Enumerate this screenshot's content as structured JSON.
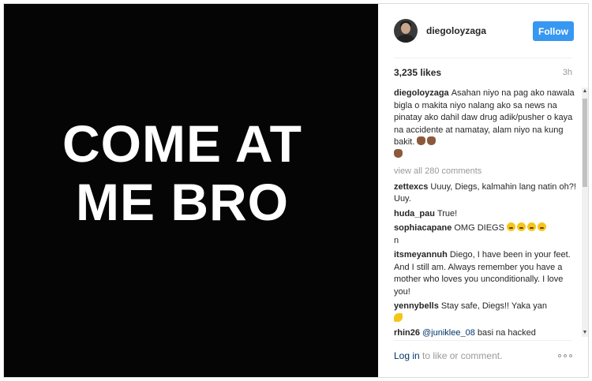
{
  "post_image": {
    "line1": "COME AT",
    "line2": "ME BRO"
  },
  "header": {
    "username": "diegoloyzaga",
    "follow_label": "Follow"
  },
  "stats": {
    "likes": "3,235 likes",
    "time": "3h"
  },
  "caption": {
    "user": "diegoloyzaga",
    "text": "Asahan niyo na pag ako nawala bigla o makita niyo nalang ako sa news na pinatay ako dahil daw drug adik/pusher o kaya na accidente at namatay, alam niyo na kung bakit."
  },
  "view_all": "view all 280 comments",
  "comments": [
    {
      "user": "zettexcs",
      "text": "Uuuy, Diegs, kalmahin lang natin oh?! Uuy."
    },
    {
      "user": "huda_pau",
      "text": "True!"
    },
    {
      "user": "sophiacapane",
      "text": "OMG DIEGS",
      "tail": "n"
    },
    {
      "user": "itsmeyannuh",
      "text": "Diego, I have been in your feet. And I still am. Always remember you have a mother who loves you unconditionally. I love you!"
    },
    {
      "user": "yennybells",
      "text": "Stay safe, Diegs!! Yaka yan"
    },
    {
      "user": "rhin26",
      "mention": "@juniklee_08",
      "text": "basi na hacked"
    }
  ],
  "footer": {
    "login": "Log in",
    "rest": "to like or comment."
  },
  "icons": {
    "more": "more-options-icon",
    "scroll_up": "scroll-up-arrow",
    "scroll_down": "scroll-down-arrow"
  },
  "colors": {
    "follow_button": "#3897f0",
    "image_background": "#050505",
    "link": "#003569"
  }
}
